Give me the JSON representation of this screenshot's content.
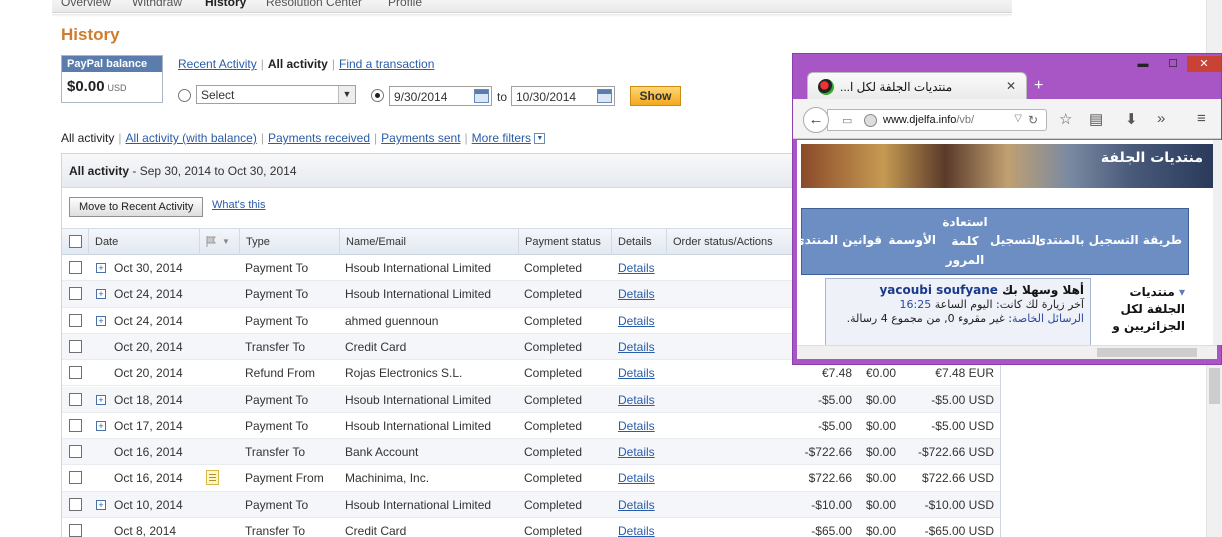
{
  "topnav": {
    "items": [
      "Overview",
      "Withdraw",
      "History",
      "Resolution Center",
      "Profile"
    ],
    "active_index": 2
  },
  "page_title": "History",
  "balance": {
    "label": "PayPal balance",
    "amount": "$0.00",
    "currency": "USD"
  },
  "views": {
    "recent": "Recent Activity",
    "all": "All activity",
    "find": "Find a transaction"
  },
  "search": {
    "select_value": "Select",
    "from_date": "9/30/2014",
    "to_label": "to",
    "to_date": "10/30/2014",
    "show_label": "Show"
  },
  "filters": {
    "all": "All activity",
    "all_balance": "All activity (with balance)",
    "received": "Payments received",
    "sent": "Payments sent",
    "more": "More filters"
  },
  "panel": {
    "title": "All activity",
    "range": "- Sep 30, 2014 to Oct 30, 2014",
    "move_button": "Move to Recent Activity",
    "whats_this": "What's this"
  },
  "columns": [
    "Date",
    "Type",
    "Name/Email",
    "Payment status",
    "Details",
    "Order status/Actions"
  ],
  "rows": [
    {
      "expand": true,
      "note": false,
      "date": "Oct 30, 2014",
      "type": "Payment To",
      "name": "Hsoub International Limited",
      "status": "Completed",
      "details": "Details",
      "gross": "",
      "fee": "",
      "net": ""
    },
    {
      "expand": true,
      "note": false,
      "date": "Oct 24, 2014",
      "type": "Payment To",
      "name": "Hsoub International Limited",
      "status": "Completed",
      "details": "Details",
      "gross": "",
      "fee": "",
      "net": ""
    },
    {
      "expand": true,
      "note": false,
      "date": "Oct 24, 2014",
      "type": "Payment To",
      "name": "ahmed guennoun",
      "status": "Completed",
      "details": "Details",
      "gross": "",
      "fee": "",
      "net": ""
    },
    {
      "expand": false,
      "note": false,
      "date": "Oct 20, 2014",
      "type": "Transfer To",
      "name": "Credit Card",
      "status": "Completed",
      "details": "Details",
      "gross": "",
      "fee": "",
      "net": ""
    },
    {
      "expand": false,
      "note": false,
      "date": "Oct 20, 2014",
      "type": "Refund From",
      "name": "Rojas Electronics S.L.",
      "status": "Completed",
      "details": "Details",
      "gross": "€7.48",
      "fee": "€0.00",
      "net": "€7.48 EUR"
    },
    {
      "expand": true,
      "note": false,
      "date": "Oct 18, 2014",
      "type": "Payment To",
      "name": "Hsoub International Limited",
      "status": "Completed",
      "details": "Details",
      "gross": "-$5.00",
      "fee": "$0.00",
      "net": "-$5.00 USD"
    },
    {
      "expand": true,
      "note": false,
      "date": "Oct 17, 2014",
      "type": "Payment To",
      "name": "Hsoub International Limited",
      "status": "Completed",
      "details": "Details",
      "gross": "-$5.00",
      "fee": "$0.00",
      "net": "-$5.00 USD"
    },
    {
      "expand": false,
      "note": false,
      "date": "Oct 16, 2014",
      "type": "Transfer To",
      "name": "Bank Account",
      "status": "Completed",
      "details": "Details",
      "gross": "-$722.66",
      "fee": "$0.00",
      "net": "-$722.66 USD"
    },
    {
      "expand": false,
      "note": true,
      "date": "Oct 16, 2014",
      "type": "Payment From",
      "name": "Machinima, Inc.",
      "status": "Completed",
      "details": "Details",
      "gross": "$722.66",
      "fee": "$0.00",
      "net": "$722.66 USD"
    },
    {
      "expand": true,
      "note": false,
      "date": "Oct 10, 2014",
      "type": "Payment To",
      "name": "Hsoub International Limited",
      "status": "Completed",
      "details": "Details",
      "gross": "-$10.00",
      "fee": "$0.00",
      "net": "-$10.00 USD"
    },
    {
      "expand": false,
      "note": false,
      "date": "Oct 8, 2014",
      "type": "Transfer To",
      "name": "Credit Card",
      "status": "Completed",
      "details": "Details",
      "gross": "-$65.00",
      "fee": "$0.00",
      "net": "-$65.00 USD"
    }
  ],
  "firefox": {
    "tab_title": "منتديات الجلفة لكل ا...",
    "url_host": "www.djelfa.info",
    "url_path": "/vb/",
    "banner_logo": "منتديات الجلفة",
    "nav": [
      "طريقة التسجيل بالمنتدى",
      "التسجيل",
      "استعادة كلمة المرور",
      "الأوسمة",
      "قوانين المنتدى"
    ],
    "welcome_prefix": "أهلا وسهلا بك",
    "welcome_user": "yacoubi soufyane",
    "last_visit_label": "آخر زيارة لك كانت: اليوم الساعة",
    "last_visit_time": "16:25",
    "pm_label": "الرسائل الخاصة",
    "pm_text": ": غير مقروء 0, من مجموع 4 رسالة.",
    "forum_cell": "منتديات الجلفة لكل الجزائريين و"
  },
  "colors": {
    "title": "#d07c2c",
    "link": "#2a5ca8",
    "show_button": "#f2a91e",
    "window_frame": "#a855c6",
    "forum_nav": "#6d8ec3"
  }
}
